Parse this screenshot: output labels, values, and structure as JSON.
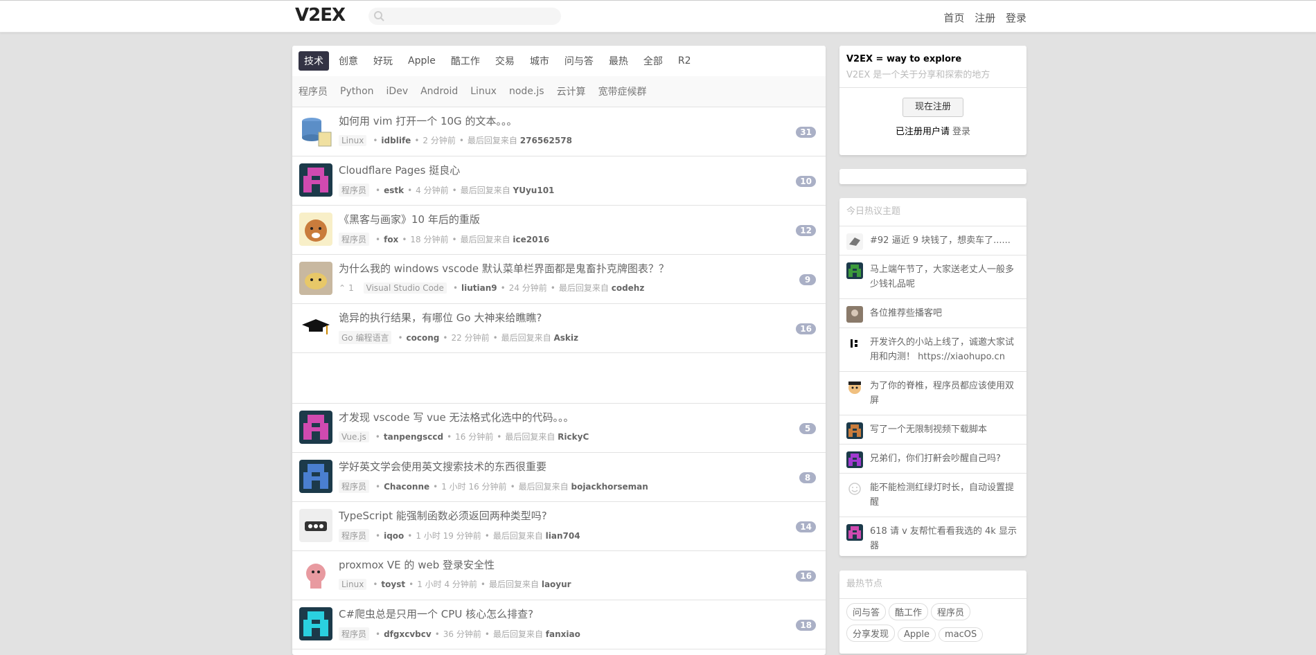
{
  "topbar": {
    "logo": "V2EX",
    "nav": [
      "首页",
      "注册",
      "登录"
    ]
  },
  "tabs": [
    "技术",
    "创意",
    "好玩",
    "Apple",
    "酷工作",
    "交易",
    "城市",
    "问与答",
    "最热",
    "全部",
    "R2"
  ],
  "subtabs": [
    "程序员",
    "Python",
    "iDev",
    "Android",
    "Linux",
    "node.js",
    "云计算",
    "宽带症候群"
  ],
  "topics": [
    {
      "title": "如何用 vim 打开一个 10G 的文本。。。",
      "node": "Linux",
      "user": "idblife",
      "time": "2 分钟前",
      "last_label": "最后回复来自",
      "last": "276562578",
      "count": "31",
      "avatar": "db",
      "color": "#5b8ec7"
    },
    {
      "title": "Cloudflare Pages 挺良心",
      "node": "程序员",
      "user": "estk",
      "time": "4 分钟前",
      "last_label": "最后回复来自",
      "last": "YUyu101",
      "count": "10",
      "avatar": "pix",
      "color": "#d04ab0"
    },
    {
      "title": "《黑客与画家》10 年后的重版",
      "node": "程序员",
      "user": "fox",
      "time": "18 分钟前",
      "last_label": "最后回复来自",
      "last": "ice2016",
      "count": "12",
      "avatar": "fox",
      "color": "#c97c3c"
    },
    {
      "title": "为什么我的 windows vscode 默认菜单栏界面都是鬼畜扑克牌图表？？",
      "node": "Visual Studio Code",
      "user": "liutian9",
      "time": "24 分钟前",
      "last_label": "最后回复来自",
      "last": "codehz",
      "count": "9",
      "avatar": "cat",
      "color": "#d4a94c",
      "votes": "1"
    },
    {
      "title": "诡异的执行结果，有哪位 Go 大神来给瞧瞧?",
      "node": "Go 编程语言",
      "user": "cocong",
      "time": "22 分钟前",
      "last_label": "最后回复来自",
      "last": "Askiz",
      "count": "16",
      "avatar": "cap",
      "color": "#222"
    },
    {
      "title": "才发现 vscode 写 vue 无法格式化选中的代码。。。",
      "node": "Vue.js",
      "user": "tanpengsccd",
      "time": "16 分钟前",
      "last_label": "最后回复来自",
      "last": "RickyC",
      "count": "5",
      "avatar": "pix",
      "color": "#d04ab0"
    },
    {
      "title": "学好英文学会使用英文搜索技术的东西很重要",
      "node": "程序员",
      "user": "Chaconne",
      "time": "1 小时 16 分钟前",
      "last_label": "最后回复来自",
      "last": "bojackhorseman",
      "count": "8",
      "avatar": "pix",
      "color": "#4a7fd0"
    },
    {
      "title": "TypeScript 能强制函数必须返回两种类型吗?",
      "node": "程序员",
      "user": "iqoo",
      "time": "1 小时 19 分钟前",
      "last_label": "最后回复来自",
      "last": "lian704",
      "count": "14",
      "avatar": "box",
      "color": "#333"
    },
    {
      "title": "proxmox VE 的 web 登录安全性",
      "node": "Linux",
      "user": "toyst",
      "time": "1 小时 4 分钟前",
      "last_label": "最后回复来自",
      "last": "laoyur",
      "count": "16",
      "avatar": "pig",
      "color": "#d88"
    },
    {
      "title": "C#爬虫总是只用一个 CPU 核心怎么排查?",
      "node": "程序员",
      "user": "dfgxcvbcv",
      "time": "36 分钟前",
      "last_label": "最后回复来自",
      "last": "fanxiao",
      "count": "18",
      "avatar": "pix",
      "color": "#2ad0e0"
    }
  ],
  "sidebar": {
    "brand": "V2EX = way to explore",
    "tagline": "V2EX 是一个关于分享和探索的地方",
    "register_btn": "现在注册",
    "already": "已注册用户请",
    "login": "登录",
    "hot_title": "今日热议主题",
    "hot": [
      {
        "text": "#92 逼近 9 块钱了，想卖车了......",
        "avatar": "bird",
        "color": "#888"
      },
      {
        "text": "马上端午节了，大家送老丈人一般多少钱礼品呢",
        "avatar": "pix",
        "color": "#3c9b3c"
      },
      {
        "text": "各位推荐些播客吧",
        "avatar": "photo",
        "color": "#888"
      },
      {
        "text": "开发许久的小站上线了，诚邀大家试用和内测！ https://xiaohupo.cn",
        "avatar": "mark",
        "color": "#000"
      },
      {
        "text": "为了你的脊椎，程序员都应该使用双屏",
        "avatar": "face",
        "color": "#f0c080"
      },
      {
        "text": "写了一个无限制视频下载脚本",
        "avatar": "pix",
        "color": "#c97c3c"
      },
      {
        "text": "兄弟们，你们打鼾会吵醒自己吗?",
        "avatar": "pix",
        "color": "#a03ad0"
      },
      {
        "text": "能不能检测红绿灯时长，自动设置提醒",
        "avatar": "smile",
        "color": "#ccc"
      },
      {
        "text": "618 请 v 友帮忙看看我选的 4k 显示器",
        "avatar": "pix",
        "color": "#d04ab0"
      }
    ],
    "nodes_title": "最热节点",
    "nodes": [
      "问与答",
      "酷工作",
      "程序员",
      "分享发现",
      "Apple",
      "macOS"
    ]
  }
}
